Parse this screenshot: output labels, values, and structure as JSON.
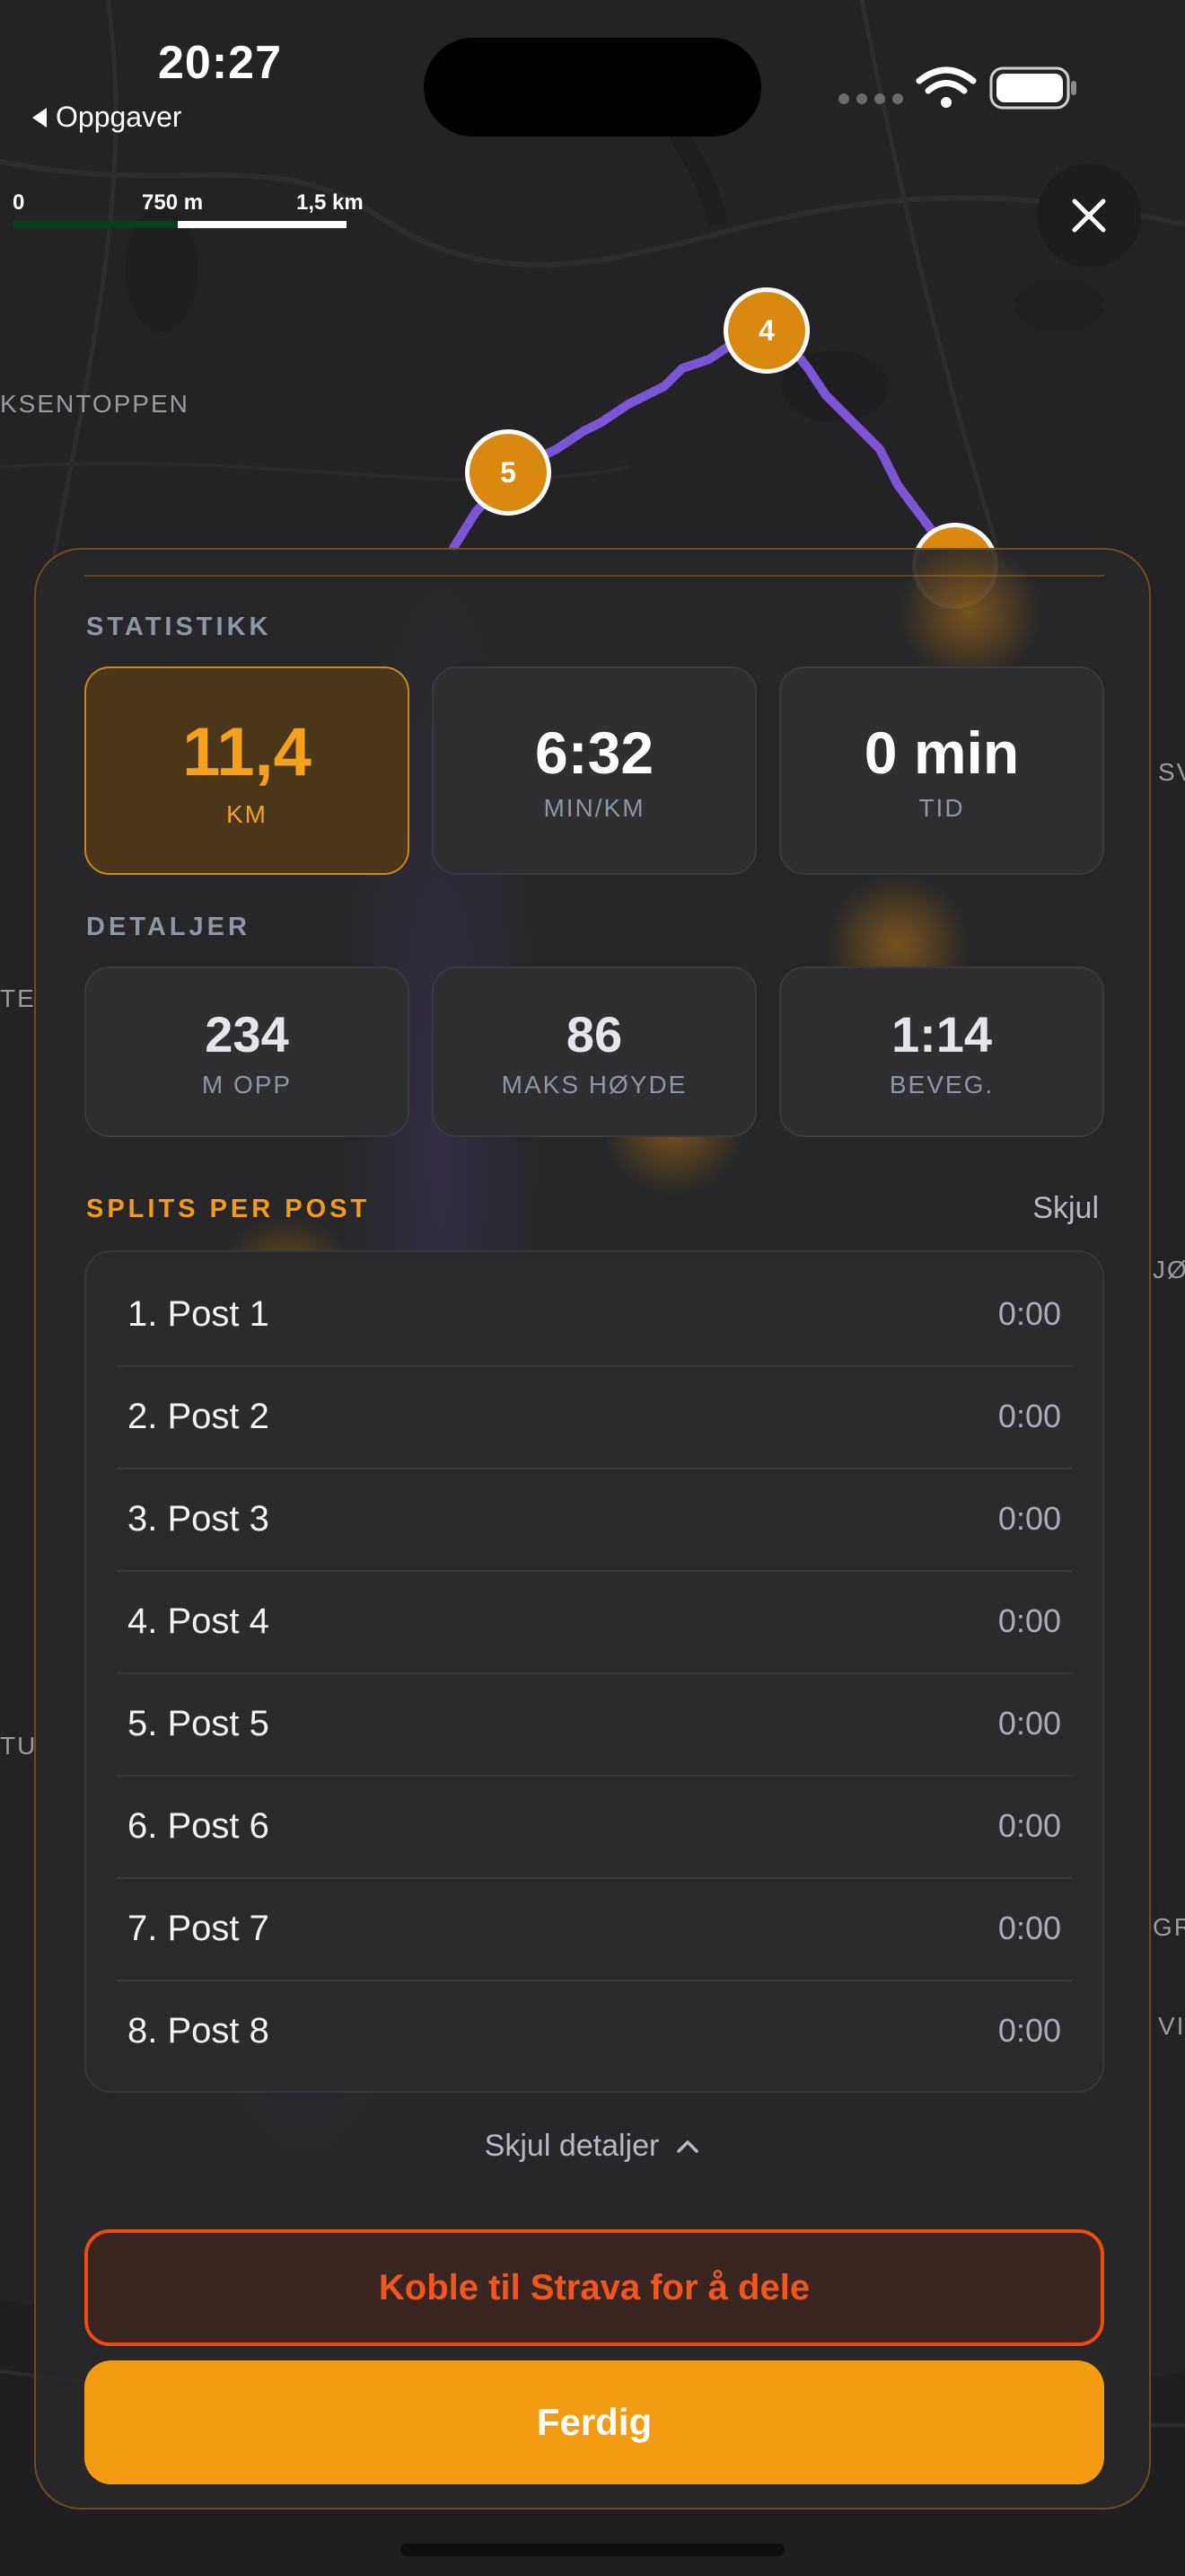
{
  "status_bar": {
    "time": "20:27",
    "back_label": "Oppgaver"
  },
  "map": {
    "scale_labels": [
      "0",
      "750 m",
      "1,5 km"
    ],
    "place_labels": [
      "KSENTOPPEN",
      "SV",
      "TE",
      "JØ",
      "TU",
      "GR",
      "VI"
    ],
    "markers": [
      "4",
      "5"
    ],
    "route_color": "#7b55d6",
    "marker_color": "#d98a0e"
  },
  "close_icon": "close-icon",
  "stats": {
    "title": "STATISTIKK",
    "cards": [
      {
        "value": "11,4",
        "unit": "KM",
        "active": true
      },
      {
        "value": "6:32",
        "unit": "MIN/KM",
        "active": false
      },
      {
        "value": "0 min",
        "unit": "TID",
        "active": false
      }
    ]
  },
  "details": {
    "title": "DETALJER",
    "cards": [
      {
        "value": "234",
        "unit": "M OPP"
      },
      {
        "value": "86",
        "unit": "MAKS HØYDE"
      },
      {
        "value": "1:14",
        "unit": "BEVEG."
      }
    ]
  },
  "splits": {
    "title": "SPLITS PER POST",
    "hide_label": "Skjul",
    "rows": [
      {
        "name": "1. Post 1",
        "time": "0:00"
      },
      {
        "name": "2. Post 2",
        "time": "0:00"
      },
      {
        "name": "3. Post 3",
        "time": "0:00"
      },
      {
        "name": "4. Post 4",
        "time": "0:00"
      },
      {
        "name": "5. Post 5",
        "time": "0:00"
      },
      {
        "name": "6. Post 6",
        "time": "0:00"
      },
      {
        "name": "7. Post 7",
        "time": "0:00"
      },
      {
        "name": "8. Post 8",
        "time": "0:00"
      }
    ]
  },
  "toggle_details_label": "Skjul detaljer",
  "strava_button_label": "Koble til Strava for å dele",
  "done_button_label": "Ferdig",
  "colors": {
    "accent": "#f39c12",
    "strava": "#f04a0e",
    "background": "#232325"
  }
}
